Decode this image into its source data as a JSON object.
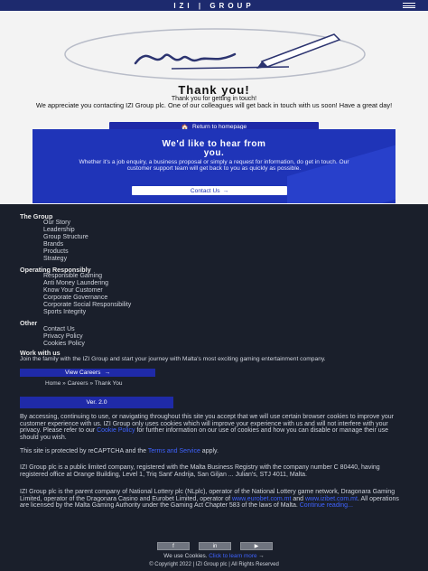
{
  "header": {
    "logo": "IZI | GROUP"
  },
  "thankyou": {
    "title": "Thank you!",
    "subtitle": "Thank you for getting in touch!",
    "description": "We appreciate you contacting IZI Group plc. One of our colleagues will get back in touch with us soon! Have a great day!",
    "home_button": "Return to homepage"
  },
  "hear": {
    "title_line1": "We'd like to hear from",
    "title_line2": "you.",
    "text": "Whether it's a job enquiry, a business proposal or simply a request for information, do get in touch. Our customer support team will get back to you as quickly as possible.",
    "contact_button": "Contact Us"
  },
  "footer": {
    "group": {
      "title": "The Group",
      "items": [
        "Our Story",
        "Leadership",
        "Group Structure",
        "Brands",
        "Products",
        "Strategy"
      ]
    },
    "responsibly": {
      "title": "Operating Responsibly",
      "items": [
        "Responsible Gaming",
        "Anti Money Laundering",
        "Know Your Customer",
        "Corporate Governance",
        "Corporate Social Responsibility",
        "Sports Integrity"
      ]
    },
    "other": {
      "title": "Other",
      "items": [
        "Contact Us",
        "Privacy Policy",
        "Cookies Policy"
      ]
    },
    "work": {
      "title": "Work with us",
      "text": "Join the family with the IZI Group and start your journey with Malta's most exciting gaming entertainment company.",
      "button": "View Careers"
    },
    "breadcrumbs": "Home » Careers » Thank You",
    "version": "Ver. 2.0",
    "para1_a": "By accessing, continuing to use, or navigating throughout this site you accept that we will use certain browser cookies to improve your customer experience with us. IZI Group only uses cookies which will improve your experience with us and will not interfere with your privacy. Please refer to our ",
    "para1_link": "Cookie Policy",
    "para1_b": " for further information on our use of cookies and how you can disable or manage their use should you wish.",
    "para2_a": "This site is protected by reCAPTCHA and the ",
    "para2_link": "Terms and Service",
    "para2_b": " apply.",
    "para3": "IZI Group plc is a public limited company, registered with the Malta Business Registry with the company number C 80440, having registered office at Orange Building, Level 1, Triq Sant' Andrija, San Giljan ... Julian's, STJ 4011, Malta.",
    "para4_a": "IZI Group plc is the parent company of National Lottery plc (NLplc), operator of the National Lottery game network, Dragonara Gaming Limited, operator of the Dragonara Casino and Eurobet Limited, operator of ",
    "para4_link": "www.eurobet.com.mt",
    "para4_b": " and ",
    "para4_link2": "www.izibet.com.mt",
    "para4_c": ". All operations are licensed by the Malta Gaming Authority under the Gaming Act Chapter 583 of the laws of Malta. ",
    "para4_link3": "Continue reading...",
    "social": [
      "f",
      "in",
      "▶"
    ],
    "cookie_note_a": "We use Cookies. ",
    "cookie_note_link": "Click to learn more",
    "copyright": "© Copyright 2022 | IZI Group plc | All Rights Reserved"
  },
  "colors": {
    "brand_blue": "#1f2aa8",
    "hero_blue": "#1f34b8",
    "footer_bg": "#1a1f2b",
    "link": "#3f63ff"
  }
}
